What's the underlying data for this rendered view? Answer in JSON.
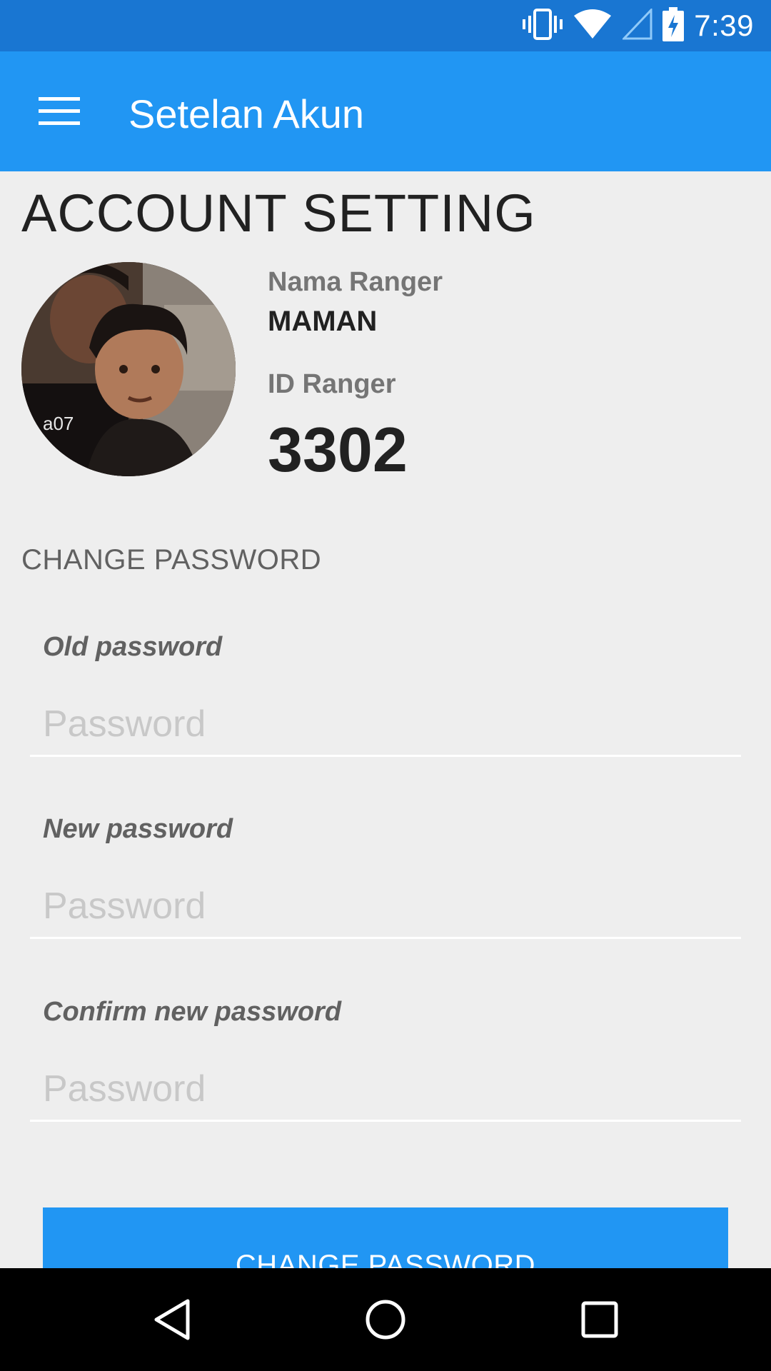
{
  "status_bar": {
    "time": "7:39",
    "icons": [
      "vibrate-icon",
      "wifi-icon",
      "cell-signal-icon",
      "battery-charging-icon"
    ],
    "color": "#1976d2"
  },
  "app_bar": {
    "title": "Setelan Akun",
    "menu_icon": "hamburger-menu-icon",
    "color": "#2196f3"
  },
  "page": {
    "heading": "ACCOUNT SETTING"
  },
  "profile": {
    "name_label": "Nama Ranger",
    "name_value": "MAMAN",
    "id_label": "ID Ranger",
    "id_value": "3302"
  },
  "change_password": {
    "section_label": "CHANGE PASSWORD",
    "fields": [
      {
        "label": "Old password",
        "placeholder": "Password",
        "value": ""
      },
      {
        "label": "New password",
        "placeholder": "Password",
        "value": ""
      },
      {
        "label": "Confirm new password",
        "placeholder": "Password",
        "value": ""
      }
    ],
    "button_label": "CHANGE PASSWORD",
    "button_color": "#2196f3"
  },
  "nav_bar": {
    "buttons": [
      "back-icon",
      "home-icon",
      "recents-icon"
    ]
  }
}
